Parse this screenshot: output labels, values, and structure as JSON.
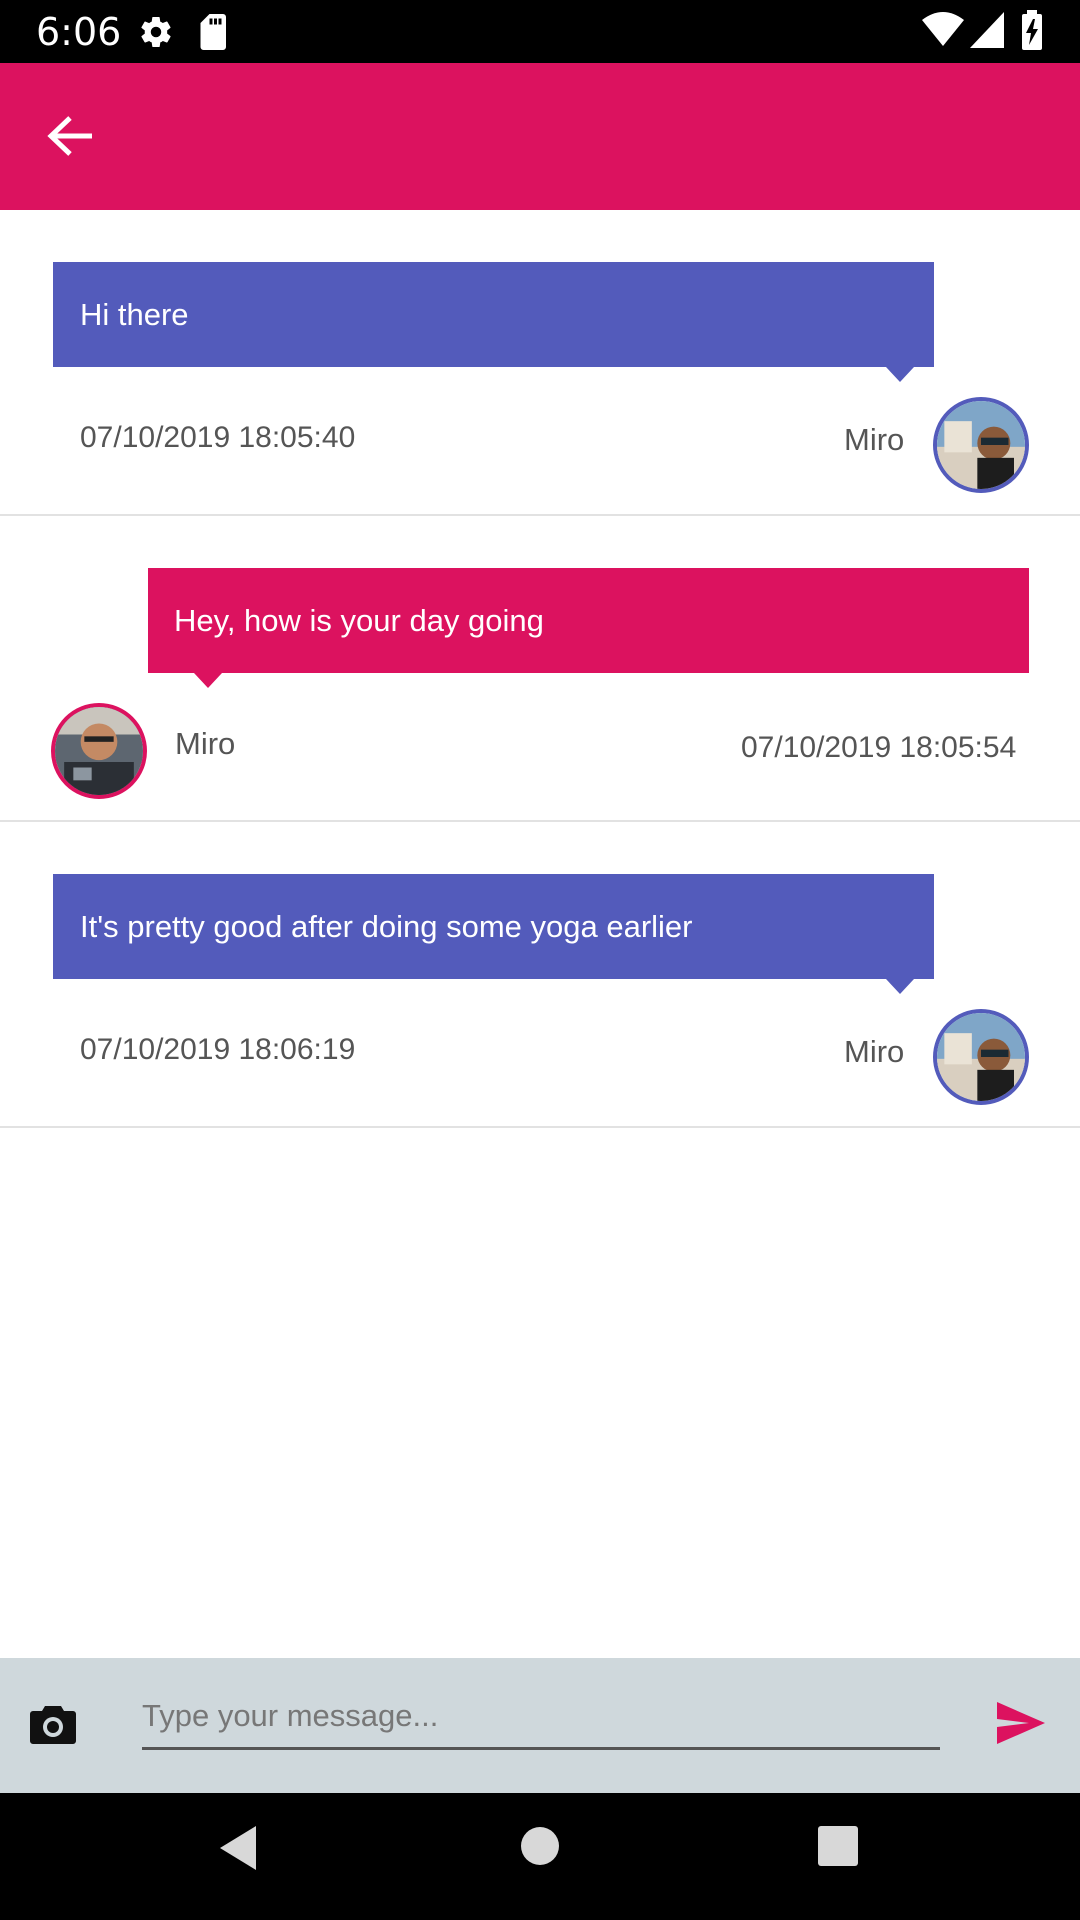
{
  "status_bar": {
    "time": "6:06",
    "icons": [
      "settings-gear-icon",
      "sd-card-icon",
      "wifi-icon",
      "cellular-signal-icon",
      "battery-charging-icon"
    ]
  },
  "app_bar": {
    "background": "#DC125F",
    "back_icon": "arrow-back-icon"
  },
  "messages": [
    {
      "text": "Hi there",
      "timestamp": "07/10/2019 18:05:40",
      "sender": "Miro",
      "bubble_color": "#535BBB"
    },
    {
      "text": "Hey, how is your day going",
      "timestamp": "07/10/2019 18:05:54",
      "sender": "Miro",
      "bubble_color": "#DC125F"
    },
    {
      "text": "It's pretty good after doing some yoga earlier",
      "timestamp": "07/10/2019 18:06:19",
      "sender": "Miro",
      "bubble_color": "#535BBB"
    }
  ],
  "composer": {
    "placeholder": "Type your message...",
    "camera_icon": "camera-icon",
    "send_icon": "send-icon",
    "send_color": "#DC125F"
  },
  "nav_bar": {
    "icons": [
      "back-triangle-icon",
      "home-circle-icon",
      "recents-square-icon"
    ]
  }
}
